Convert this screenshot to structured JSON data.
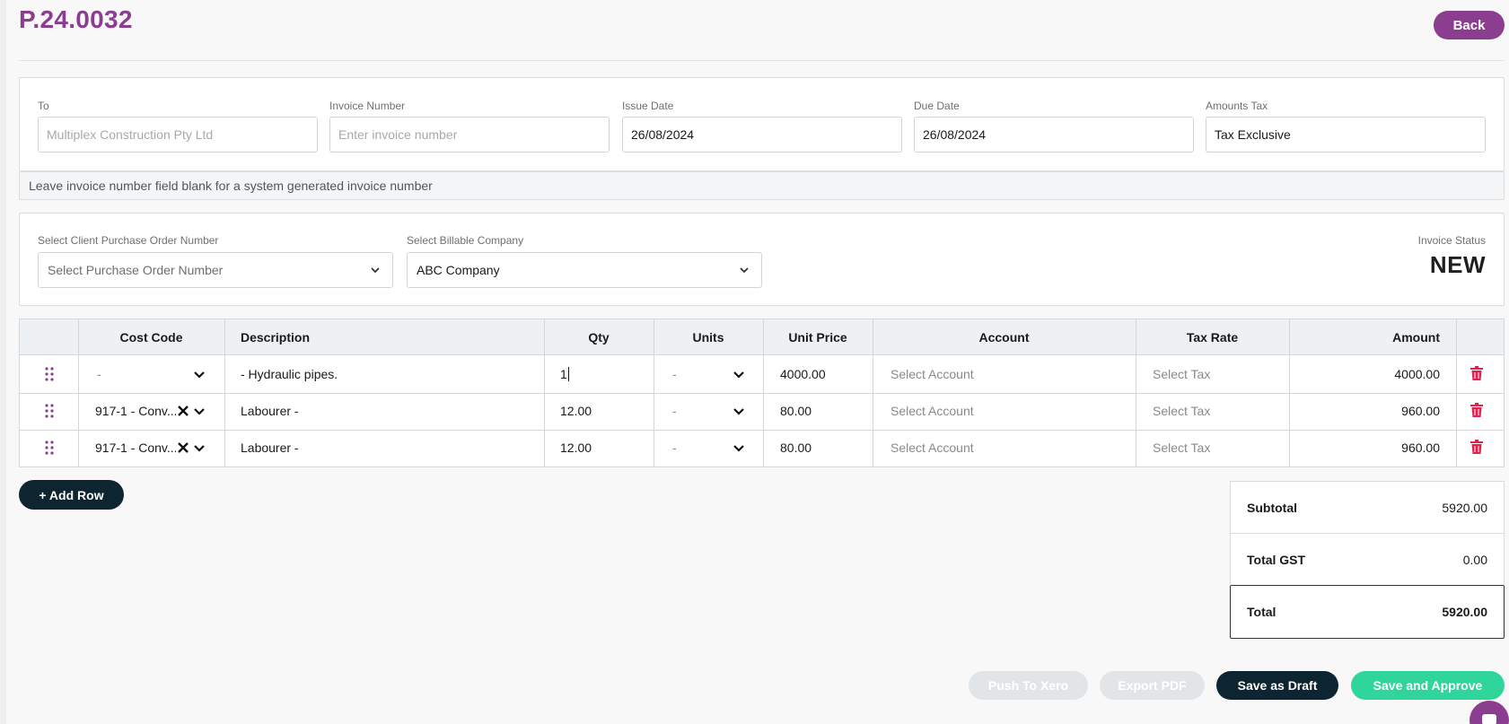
{
  "header": {
    "title": "P.24.0032",
    "back_label": "Back"
  },
  "invoice_fields": {
    "to": {
      "label": "To",
      "placeholder": "Multiplex Construction Pty Ltd"
    },
    "invoice_number": {
      "label": "Invoice Number",
      "placeholder": "Enter invoice number"
    },
    "issue_date": {
      "label": "Issue Date",
      "value": "26/08/2024"
    },
    "due_date": {
      "label": "Due Date",
      "value": "26/08/2024"
    },
    "amounts_tax": {
      "label": "Amounts Tax",
      "value": "Tax Exclusive"
    }
  },
  "hint": "Leave invoice number field blank for a system generated invoice number",
  "selects": {
    "purchase_order": {
      "label": "Select Client Purchase Order Number",
      "placeholder": "Select Purchase Order Number"
    },
    "billable_company": {
      "label": "Select Billable Company",
      "value": "ABC Company"
    }
  },
  "status": {
    "label": "Invoice Status",
    "value": "NEW"
  },
  "table": {
    "headers": {
      "cost_code": "Cost Code",
      "description": "Description",
      "qty": "Qty",
      "units": "Units",
      "unit_price": "Unit Price",
      "account": "Account",
      "tax_rate": "Tax Rate",
      "amount": "Amount"
    },
    "rows": [
      {
        "cost_code": "-",
        "description": " - Hydraulic pipes.",
        "qty": "1",
        "units": "-",
        "unit_price": "4000.00",
        "account": "Select Account",
        "tax_rate": "Select Tax",
        "amount": "4000.00"
      },
      {
        "cost_code": "917-1 - Conv...",
        "description": "Labourer -",
        "qty": "12.00",
        "units": "-",
        "unit_price": "80.00",
        "account": "Select Account",
        "tax_rate": "Select Tax",
        "amount": "960.00"
      },
      {
        "cost_code": "917-1 - Conv...",
        "description": "Labourer -",
        "qty": "12.00",
        "units": "-",
        "unit_price": "80.00",
        "account": "Select Account",
        "tax_rate": "Select Tax",
        "amount": "960.00"
      }
    ]
  },
  "add_row_label": "+ Add Row",
  "totals": {
    "subtotal_label": "Subtotal",
    "subtotal": "5920.00",
    "gst_label": "Total GST",
    "gst": "0.00",
    "total_label": "Total",
    "total": "5920.00"
  },
  "actions": {
    "push_xero": "Push To Xero",
    "export_pdf": "Export PDF",
    "save_draft": "Save as Draft",
    "save_approve": "Save and Approve"
  },
  "colors": {
    "brand": "#8b3d8f",
    "dark": "#0c2530",
    "success": "#2fd59a",
    "danger": "#e0234e"
  },
  "icons": [
    "drag-handle-icon",
    "chevron-down-icon",
    "clear-x-icon",
    "trash-icon",
    "chat-icon"
  ]
}
